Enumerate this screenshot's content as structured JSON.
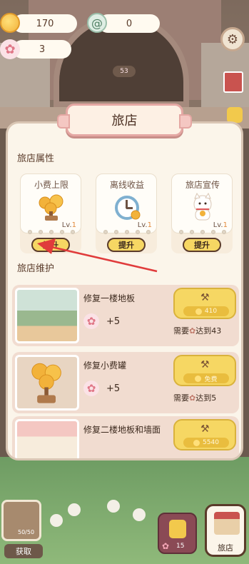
{
  "hud": {
    "coins": "170",
    "swirl": "0",
    "blossoms": "3",
    "sign_count": "53"
  },
  "panel": {
    "title": "旅店",
    "attributes_label": "旅店属性",
    "attributes": [
      {
        "name": "小费上限",
        "lv_prefix": "Lv.",
        "lv": "1",
        "button": "提升",
        "icon": "coin-tree-icon"
      },
      {
        "name": "离线收益",
        "lv_prefix": "Lv.",
        "lv": "1",
        "button": "提升",
        "icon": "alarm-clock-icon"
      },
      {
        "name": "旅店宣传",
        "lv_prefix": "Lv.",
        "lv": "1",
        "button": "提升",
        "icon": "lucky-cat-icon"
      }
    ],
    "maintenance_label": "旅店维护",
    "maintenance": [
      {
        "name": "修复一楼地板",
        "reward": "+5",
        "price": "410",
        "need_prefix": "需要",
        "need_suffix": "达到43"
      },
      {
        "name": "修复小费罐",
        "reward": "+5",
        "price": "免费",
        "need_prefix": "需要",
        "need_suffix": "达到5"
      },
      {
        "name": "修复二楼地板和墙面",
        "reward": "",
        "price": "5540",
        "need_prefix": "",
        "need_suffix": ""
      }
    ]
  },
  "bottom": {
    "album_count": "50/50",
    "get_button": "获取",
    "locked_count": "15",
    "shop_label": "旅店"
  },
  "colors": {
    "accent_yellow": "#f6d763",
    "panel_bg": "#fbf5ea",
    "pink_border": "#e4a7a3",
    "arrow_red": "#e03b3b"
  }
}
